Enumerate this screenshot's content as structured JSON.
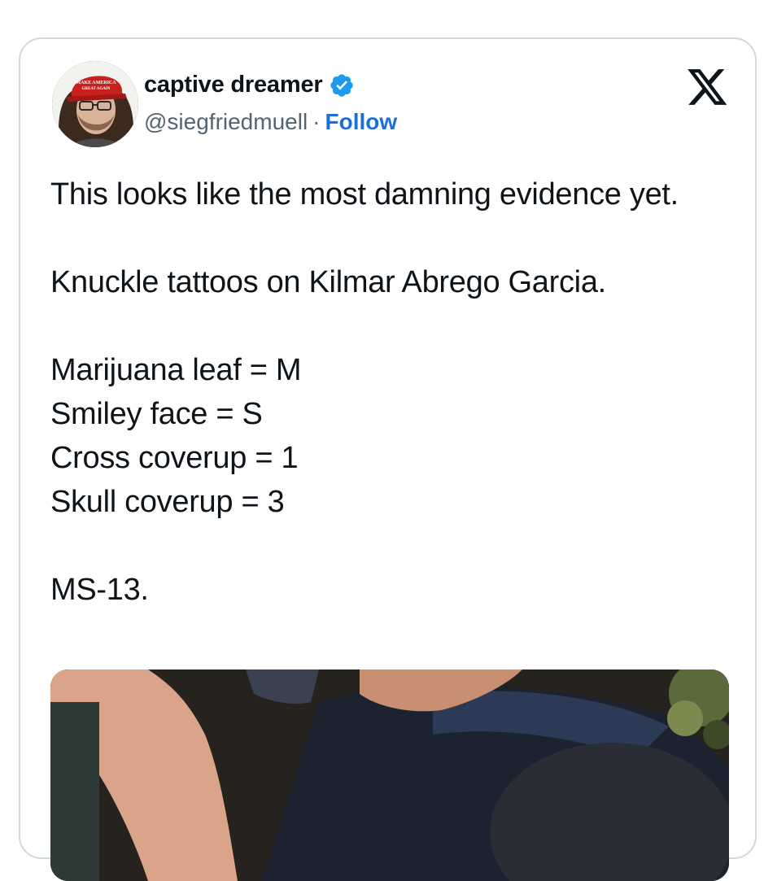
{
  "tweet": {
    "author": {
      "display_name": "captive dreamer",
      "handle": "@siegfriedmuell",
      "separator": "·",
      "follow_label": "Follow",
      "verified": true,
      "avatar_hat_text": "MAKE AMERICA GREAT AGAIN"
    },
    "platform_icon": "x-logo-icon",
    "paragraphs": [
      "This looks like the most damning evidence yet.",
      "Knuckle tattoos on Kilmar Abrego Garcia.",
      "Marijuana leaf = M\nSmiley face = S\nCross coverup = 1\nSkull coverup = 3",
      "MS-13."
    ]
  },
  "colors": {
    "text": "#0f1419",
    "secondary_text": "#536471",
    "link": "#1d6ed8",
    "verified_badge": "#1d9bf0",
    "card_border": "#cfd9de"
  }
}
